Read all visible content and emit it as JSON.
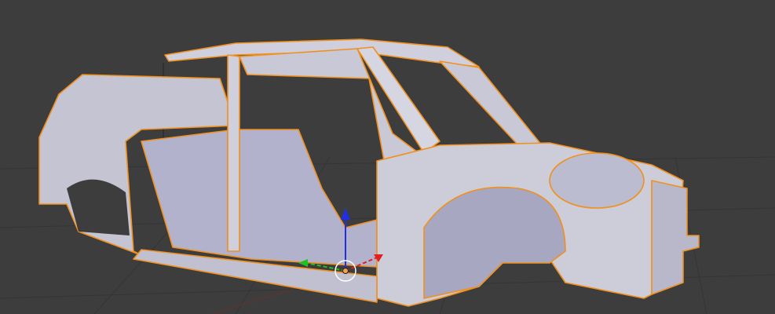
{
  "viewport": {
    "mode": "3d-viewport",
    "background_color": "#3d3d3d",
    "grid_color": "#353535",
    "selection_outline_color": "#f0901e",
    "mesh_color": "#c9c9d6",
    "mesh_shadow_color": "#9c9cb8"
  },
  "gizmo": {
    "icon": "transform-gizmo-icon",
    "x_axis_color": "#e02020",
    "y_axis_color": "#20c020",
    "z_axis_color": "#2030e0",
    "pivot_color": "#f0a050"
  },
  "object": {
    "icon": "car-body-mesh-icon",
    "selected": true
  }
}
